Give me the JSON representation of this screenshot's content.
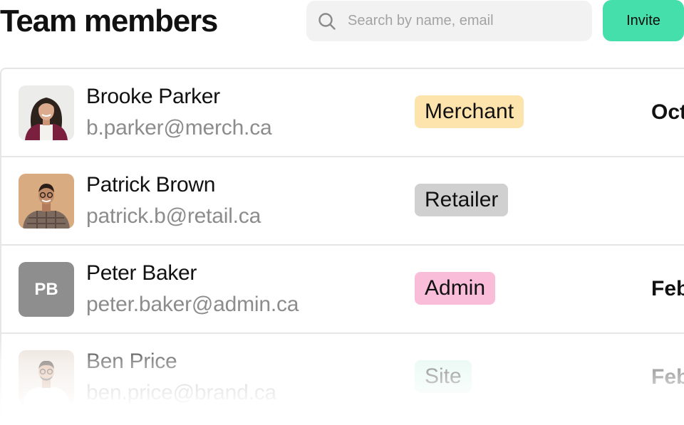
{
  "header": {
    "title": "Team members",
    "search_placeholder": "Search by name, email",
    "invite_label": "Invite"
  },
  "colors": {
    "invite_button": "#45dfac",
    "badge_merchant": "#fde4ad",
    "badge_retailer": "#d0d0d0",
    "badge_admin": "#f9bcd9",
    "badge_site": "#d6f4ea",
    "avatar_initials_bg": "#8e8e8e"
  },
  "members": [
    {
      "name": "Brooke Parker",
      "email": "b.parker@merch.ca",
      "role": "Merchant",
      "date": "Oct",
      "avatar": "photo"
    },
    {
      "name": "Patrick Brown",
      "email": "patrick.b@retail.ca",
      "role": "Retailer",
      "date": "",
      "avatar": "photo"
    },
    {
      "name": "Peter Baker",
      "email": "peter.baker@admin.ca",
      "role": "Admin",
      "date": "Feb",
      "avatar": "initials",
      "initials": "PB"
    },
    {
      "name": "Ben Price",
      "email": "ben.price@brand.ca",
      "role": "Site",
      "date": "Feb",
      "avatar": "photo"
    }
  ]
}
